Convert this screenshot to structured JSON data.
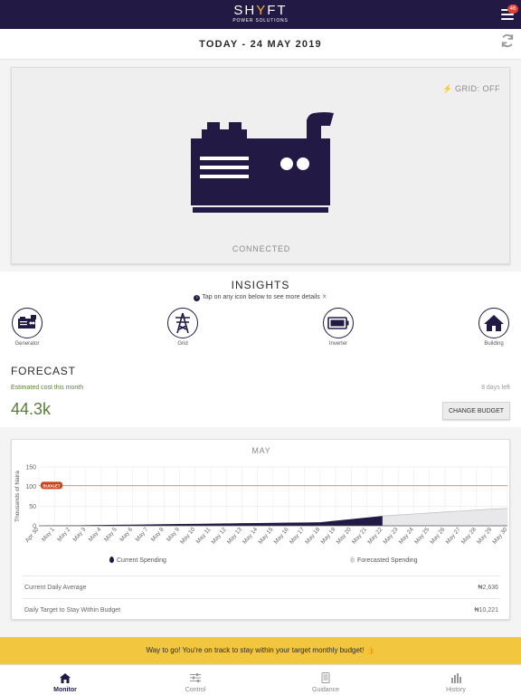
{
  "header": {
    "logo_main_before": "SH",
    "logo_main_accent": "Y",
    "logo_main_after": "FT",
    "logo_sub": "POWER SOLUTIONS",
    "notification_count": "46"
  },
  "date_bar": {
    "title": "TODAY - 24 MAY 2019"
  },
  "status": {
    "grid_status": "GRID: OFF",
    "connection": "CONNECTED"
  },
  "insights": {
    "title": "INSIGHTS",
    "hint": "Tap on any icon below to see more details",
    "items": [
      {
        "label": "Generator",
        "icon": "generator-icon"
      },
      {
        "label": "Grid",
        "icon": "pylon-icon"
      },
      {
        "label": "Inverter",
        "icon": "battery-icon"
      },
      {
        "label": "Building",
        "icon": "house-icon"
      }
    ]
  },
  "forecast": {
    "title": "FORECAST",
    "estimated_label": "Estimated cost this month",
    "estimated_value": "44.3k",
    "days_left": "8 days left",
    "change_budget_label": "CHANGE BUDGET"
  },
  "chart_data": {
    "type": "area",
    "title": "MAY",
    "ylabel": "Thousands of Naira",
    "ylim": [
      0,
      150
    ],
    "yticks": [
      0,
      50,
      100,
      150
    ],
    "budget_label": "BUDGET",
    "budget_value": 103,
    "categories": [
      "Apr 30",
      "May 1",
      "May 2",
      "May 3",
      "May 4",
      "May 5",
      "May 6",
      "May 7",
      "May 8",
      "May 9",
      "May 10",
      "May 11",
      "May 12",
      "May 13",
      "May 14",
      "May 15",
      "May 16",
      "May 17",
      "May 18",
      "May 19",
      "May 20",
      "May 21",
      "May 22",
      "May 23",
      "May 24",
      "May 25",
      "May 26",
      "May 27",
      "May 28",
      "May 29",
      "May 30"
    ],
    "series": [
      {
        "name": "Current Spending",
        "color": "#221a45",
        "values": [
          0,
          0.5,
          1,
          1.5,
          2,
          2.5,
          3,
          3.5,
          4,
          4.5,
          5,
          5.5,
          6,
          6.5,
          7,
          7.5,
          8,
          8.5,
          9,
          13,
          17,
          21,
          25
        ]
      },
      {
        "name": "Forecasted Spending",
        "color": "#d6d6d8",
        "x_start": 22,
        "values": [
          25,
          27.5,
          30,
          32.5,
          35,
          37.5,
          40,
          42.5,
          44.3
        ]
      }
    ]
  },
  "stats": {
    "current_daily_label": "Current Daily Average",
    "current_daily_value": "₦2,636",
    "daily_target_label": "Daily Target to Stay Within Budget",
    "daily_target_value": "₦10,221"
  },
  "banner": {
    "message": "Way to go! You're on track to stay within your target monthly budget! 👍"
  },
  "tabs": [
    {
      "label": "Monitor",
      "icon": "home-icon",
      "active": true
    },
    {
      "label": "Control",
      "icon": "sliders-icon",
      "active": false
    },
    {
      "label": "Guidance",
      "icon": "tablet-icon",
      "active": false
    },
    {
      "label": "History",
      "icon": "bar-chart-icon",
      "active": false
    }
  ],
  "colors": {
    "brand": "#221a45",
    "accent": "#f5b21b",
    "budget_line": "#e07a5f",
    "budget_badge": "#c9461c",
    "positive": "#5a7d3a",
    "banner": "#f3c63f"
  }
}
